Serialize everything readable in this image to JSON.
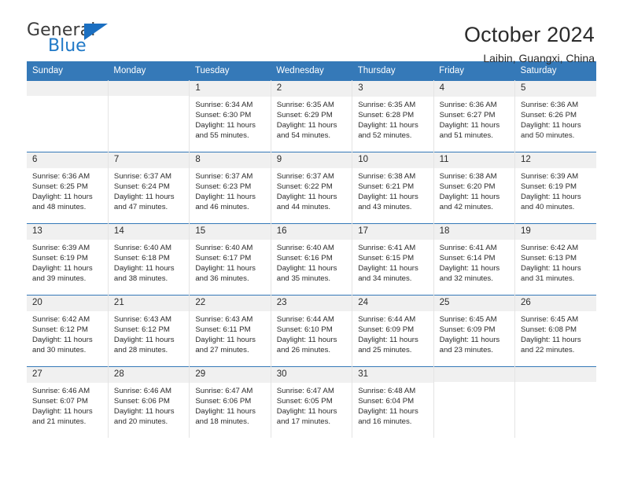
{
  "brand": {
    "word_one": "General",
    "word_two": "Blue",
    "triangle_icon": "triangle-icon",
    "accent_color": "#2079c7"
  },
  "header": {
    "title": "October 2024",
    "subtitle": "Laibin, Guangxi, China"
  },
  "calendar": {
    "header_bg": "#3579b8",
    "daynum_bg": "#f0f0f0",
    "weekdays": [
      "Sunday",
      "Monday",
      "Tuesday",
      "Wednesday",
      "Thursday",
      "Friday",
      "Saturday"
    ],
    "weeks": [
      [
        {
          "day": ""
        },
        {
          "day": ""
        },
        {
          "day": "1",
          "sunrise": "Sunrise: 6:34 AM",
          "sunset": "Sunset: 6:30 PM",
          "daylight_line1": "Daylight: 11 hours",
          "daylight_line2": "and 55 minutes."
        },
        {
          "day": "2",
          "sunrise": "Sunrise: 6:35 AM",
          "sunset": "Sunset: 6:29 PM",
          "daylight_line1": "Daylight: 11 hours",
          "daylight_line2": "and 54 minutes."
        },
        {
          "day": "3",
          "sunrise": "Sunrise: 6:35 AM",
          "sunset": "Sunset: 6:28 PM",
          "daylight_line1": "Daylight: 11 hours",
          "daylight_line2": "and 52 minutes."
        },
        {
          "day": "4",
          "sunrise": "Sunrise: 6:36 AM",
          "sunset": "Sunset: 6:27 PM",
          "daylight_line1": "Daylight: 11 hours",
          "daylight_line2": "and 51 minutes."
        },
        {
          "day": "5",
          "sunrise": "Sunrise: 6:36 AM",
          "sunset": "Sunset: 6:26 PM",
          "daylight_line1": "Daylight: 11 hours",
          "daylight_line2": "and 50 minutes."
        }
      ],
      [
        {
          "day": "6",
          "sunrise": "Sunrise: 6:36 AM",
          "sunset": "Sunset: 6:25 PM",
          "daylight_line1": "Daylight: 11 hours",
          "daylight_line2": "and 48 minutes."
        },
        {
          "day": "7",
          "sunrise": "Sunrise: 6:37 AM",
          "sunset": "Sunset: 6:24 PM",
          "daylight_line1": "Daylight: 11 hours",
          "daylight_line2": "and 47 minutes."
        },
        {
          "day": "8",
          "sunrise": "Sunrise: 6:37 AM",
          "sunset": "Sunset: 6:23 PM",
          "daylight_line1": "Daylight: 11 hours",
          "daylight_line2": "and 46 minutes."
        },
        {
          "day": "9",
          "sunrise": "Sunrise: 6:37 AM",
          "sunset": "Sunset: 6:22 PM",
          "daylight_line1": "Daylight: 11 hours",
          "daylight_line2": "and 44 minutes."
        },
        {
          "day": "10",
          "sunrise": "Sunrise: 6:38 AM",
          "sunset": "Sunset: 6:21 PM",
          "daylight_line1": "Daylight: 11 hours",
          "daylight_line2": "and 43 minutes."
        },
        {
          "day": "11",
          "sunrise": "Sunrise: 6:38 AM",
          "sunset": "Sunset: 6:20 PM",
          "daylight_line1": "Daylight: 11 hours",
          "daylight_line2": "and 42 minutes."
        },
        {
          "day": "12",
          "sunrise": "Sunrise: 6:39 AM",
          "sunset": "Sunset: 6:19 PM",
          "daylight_line1": "Daylight: 11 hours",
          "daylight_line2": "and 40 minutes."
        }
      ],
      [
        {
          "day": "13",
          "sunrise": "Sunrise: 6:39 AM",
          "sunset": "Sunset: 6:19 PM",
          "daylight_line1": "Daylight: 11 hours",
          "daylight_line2": "and 39 minutes."
        },
        {
          "day": "14",
          "sunrise": "Sunrise: 6:40 AM",
          "sunset": "Sunset: 6:18 PM",
          "daylight_line1": "Daylight: 11 hours",
          "daylight_line2": "and 38 minutes."
        },
        {
          "day": "15",
          "sunrise": "Sunrise: 6:40 AM",
          "sunset": "Sunset: 6:17 PM",
          "daylight_line1": "Daylight: 11 hours",
          "daylight_line2": "and 36 minutes."
        },
        {
          "day": "16",
          "sunrise": "Sunrise: 6:40 AM",
          "sunset": "Sunset: 6:16 PM",
          "daylight_line1": "Daylight: 11 hours",
          "daylight_line2": "and 35 minutes."
        },
        {
          "day": "17",
          "sunrise": "Sunrise: 6:41 AM",
          "sunset": "Sunset: 6:15 PM",
          "daylight_line1": "Daylight: 11 hours",
          "daylight_line2": "and 34 minutes."
        },
        {
          "day": "18",
          "sunrise": "Sunrise: 6:41 AM",
          "sunset": "Sunset: 6:14 PM",
          "daylight_line1": "Daylight: 11 hours",
          "daylight_line2": "and 32 minutes."
        },
        {
          "day": "19",
          "sunrise": "Sunrise: 6:42 AM",
          "sunset": "Sunset: 6:13 PM",
          "daylight_line1": "Daylight: 11 hours",
          "daylight_line2": "and 31 minutes."
        }
      ],
      [
        {
          "day": "20",
          "sunrise": "Sunrise: 6:42 AM",
          "sunset": "Sunset: 6:12 PM",
          "daylight_line1": "Daylight: 11 hours",
          "daylight_line2": "and 30 minutes."
        },
        {
          "day": "21",
          "sunrise": "Sunrise: 6:43 AM",
          "sunset": "Sunset: 6:12 PM",
          "daylight_line1": "Daylight: 11 hours",
          "daylight_line2": "and 28 minutes."
        },
        {
          "day": "22",
          "sunrise": "Sunrise: 6:43 AM",
          "sunset": "Sunset: 6:11 PM",
          "daylight_line1": "Daylight: 11 hours",
          "daylight_line2": "and 27 minutes."
        },
        {
          "day": "23",
          "sunrise": "Sunrise: 6:44 AM",
          "sunset": "Sunset: 6:10 PM",
          "daylight_line1": "Daylight: 11 hours",
          "daylight_line2": "and 26 minutes."
        },
        {
          "day": "24",
          "sunrise": "Sunrise: 6:44 AM",
          "sunset": "Sunset: 6:09 PM",
          "daylight_line1": "Daylight: 11 hours",
          "daylight_line2": "and 25 minutes."
        },
        {
          "day": "25",
          "sunrise": "Sunrise: 6:45 AM",
          "sunset": "Sunset: 6:09 PM",
          "daylight_line1": "Daylight: 11 hours",
          "daylight_line2": "and 23 minutes."
        },
        {
          "day": "26",
          "sunrise": "Sunrise: 6:45 AM",
          "sunset": "Sunset: 6:08 PM",
          "daylight_line1": "Daylight: 11 hours",
          "daylight_line2": "and 22 minutes."
        }
      ],
      [
        {
          "day": "27",
          "sunrise": "Sunrise: 6:46 AM",
          "sunset": "Sunset: 6:07 PM",
          "daylight_line1": "Daylight: 11 hours",
          "daylight_line2": "and 21 minutes."
        },
        {
          "day": "28",
          "sunrise": "Sunrise: 6:46 AM",
          "sunset": "Sunset: 6:06 PM",
          "daylight_line1": "Daylight: 11 hours",
          "daylight_line2": "and 20 minutes."
        },
        {
          "day": "29",
          "sunrise": "Sunrise: 6:47 AM",
          "sunset": "Sunset: 6:06 PM",
          "daylight_line1": "Daylight: 11 hours",
          "daylight_line2": "and 18 minutes."
        },
        {
          "day": "30",
          "sunrise": "Sunrise: 6:47 AM",
          "sunset": "Sunset: 6:05 PM",
          "daylight_line1": "Daylight: 11 hours",
          "daylight_line2": "and 17 minutes."
        },
        {
          "day": "31",
          "sunrise": "Sunrise: 6:48 AM",
          "sunset": "Sunset: 6:04 PM",
          "daylight_line1": "Daylight: 11 hours",
          "daylight_line2": "and 16 minutes."
        },
        {
          "day": ""
        },
        {
          "day": ""
        }
      ]
    ]
  }
}
